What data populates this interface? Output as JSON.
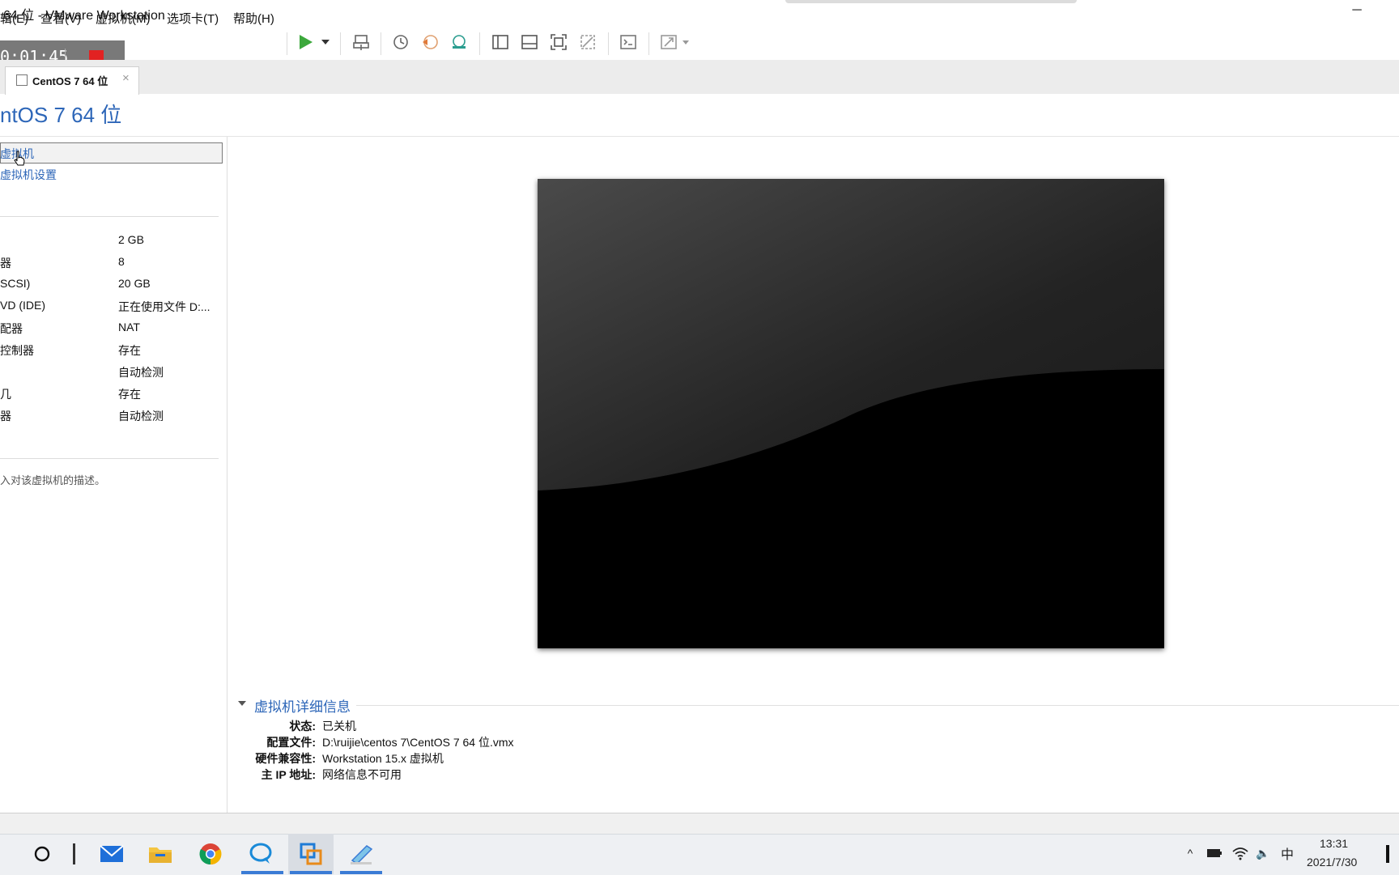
{
  "window": {
    "title": "64 位 - VMware Workstation",
    "minimize_glyph": "─"
  },
  "menu": {
    "items": [
      "辑(E)",
      "查看(V)",
      "虚拟机(M)",
      "选项卡(T)",
      "帮助(H)"
    ]
  },
  "toolbar": {
    "icons": [
      "play-icon",
      "dropdown-arrow-icon",
      "send-ctrl-alt-del-icon",
      "snapshot-icon",
      "revert-snapshot-icon",
      "snapshot-manager-icon",
      "library-view-icon",
      "thumbnail-bar-icon",
      "full-screen-icon",
      "unity-icon",
      "console-view-icon",
      "stretch-guest-icon"
    ],
    "accent_color": "#3ca83c"
  },
  "recording": {
    "time": "0:01:45",
    "stop_color": "#e22222"
  },
  "tab": {
    "label": "CentOS 7 64 位",
    "close": "×"
  },
  "vm": {
    "title": "ntOS 7 64 位"
  },
  "actions": {
    "power_on": "虚拟机",
    "edit_settings": "虚拟机设置"
  },
  "devices": [
    {
      "name": "",
      "value": "2 GB"
    },
    {
      "name": "器",
      "value": "8"
    },
    {
      "name": "SCSI)",
      "value": "20 GB"
    },
    {
      "name": "VD (IDE)",
      "value": "正在使用文件 D:..."
    },
    {
      "name": "配器",
      "value": "NAT"
    },
    {
      "name": "控制器",
      "value": "存在"
    },
    {
      "name": "",
      "value": "自动检测"
    },
    {
      "name": "几",
      "value": "存在"
    },
    {
      "name": "器",
      "value": "自动检测"
    }
  ],
  "description": {
    "placeholder": "入对该虚拟机的描述。"
  },
  "details": {
    "title": "虚拟机详细信息",
    "rows": [
      {
        "label": "状态:",
        "value": "已关机"
      },
      {
        "label": "配置文件:",
        "value": "D:\\ruijie\\centos 7\\CentOS 7 64 位.vmx"
      },
      {
        "label": "硬件兼容性:",
        "value": "Workstation 15.x 虚拟机"
      },
      {
        "label": "主 IP 地址:",
        "value": "网络信息不可用"
      }
    ]
  },
  "taskbar": {
    "apps": [
      "search-circle-icon",
      "mail-icon",
      "file-explorer-icon",
      "chrome-icon",
      "chat-icon",
      "vmware-icon",
      "notepad-icon"
    ],
    "tray": {
      "chevron": "^",
      "ime": "中",
      "volume": "🔈"
    },
    "time": "13:31",
    "date": "2021/7/30"
  }
}
